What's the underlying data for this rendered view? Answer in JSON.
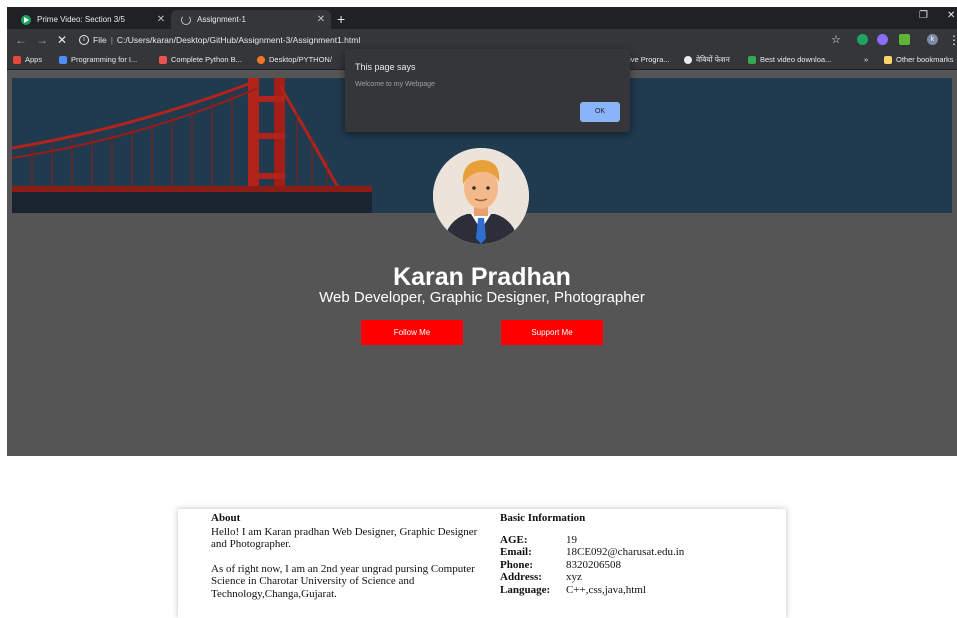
{
  "browser": {
    "tabs": [
      {
        "title": "Prime Video: Section 3/5",
        "icon": "prime-video-icon",
        "active": false
      },
      {
        "title": "Assignment-1",
        "icon": "loading-icon",
        "active": true
      }
    ],
    "new_tab_label": "+",
    "address": {
      "scheme_label": "File",
      "url": "C:/Users/karan/Desktop/GitHub/Assignment-3/Assignment1.html"
    },
    "bookmarks": [
      {
        "label": "Apps",
        "icon": "apps-grid-icon",
        "color": "#e8453c"
      },
      {
        "label": "Programming for I...",
        "icon": "coursera-icon",
        "color": "#4f8ef7"
      },
      {
        "label": "Complete Python B...",
        "icon": "udemy-icon",
        "color": "#ec5252"
      },
      {
        "label": "Desktop/PYTHON/",
        "icon": "jupyter-icon",
        "color": "#f37626"
      },
      {
        "label": "tive Progra...",
        "icon": "",
        "color": ""
      },
      {
        "label": "वेबियों फेशन",
        "icon": "globe-icon",
        "color": "#e8eaed"
      },
      {
        "label": "Best video downloa...",
        "icon": "download-icon",
        "color": "#34a853"
      },
      {
        "label": "»",
        "icon": "",
        "color": ""
      },
      {
        "label": "Other bookmarks",
        "icon": "folder-icon",
        "color": "#f9d66b"
      }
    ],
    "profile_initial": "k"
  },
  "dialog": {
    "title": "This page says",
    "message": "Welcome to my Webpage",
    "ok_label": "OK"
  },
  "hero": {
    "name": "Karan Pradhan",
    "roles": "Web Developer, Graphic Designer, Photographer",
    "follow_label": "Follow Me",
    "support_label": "Support Me",
    "button_color": "#ff0000"
  },
  "about": {
    "heading": "About",
    "paragraph1": "Hello! I am Karan pradhan Web Designer, Graphic Designer and Photographer.",
    "paragraph2": "As of right now, I am an 2nd year ungrad pursing Computer Science in Charotar University of Science and Technology,Changa,Gujarat."
  },
  "basic_info": {
    "heading": "Basic Information",
    "rows": [
      {
        "key": "AGE:",
        "value": "19"
      },
      {
        "key": "Email:",
        "value": "18CE092@charusat.edu.in"
      },
      {
        "key": "Phone:",
        "value": "8320206508"
      },
      {
        "key": "Address:",
        "value": "xyz"
      },
      {
        "key": "Language:",
        "value": "C++,css,java,html"
      }
    ]
  }
}
